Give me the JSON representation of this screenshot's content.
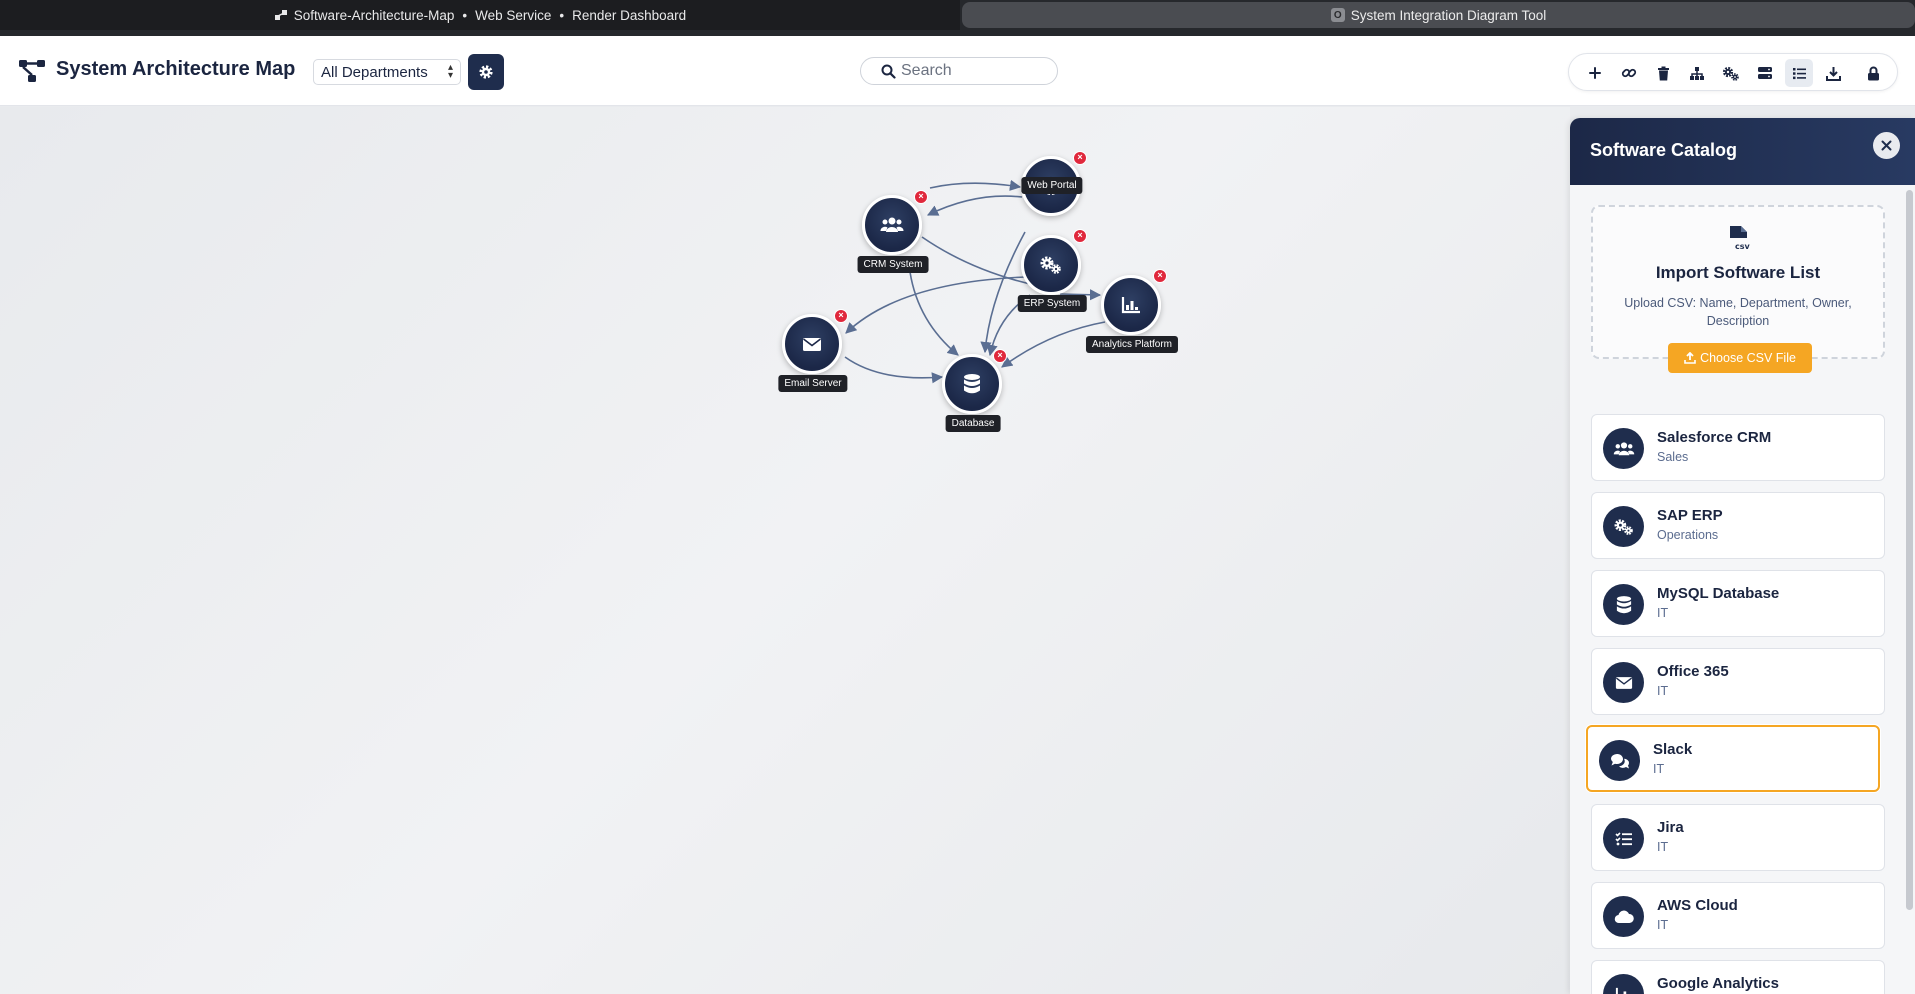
{
  "browser": {
    "tab_left": {
      "title": "Software-Architecture-Map",
      "sep1": "•",
      "part2": "Web Service",
      "sep2": "•",
      "part3": "Render Dashboard"
    },
    "tab_right": {
      "favicon_letter": "O",
      "title": "System Integration Diagram Tool"
    }
  },
  "header": {
    "title": "System Architecture Map",
    "department_select": {
      "value": "All Departments"
    },
    "search": {
      "placeholder": "Search"
    },
    "toolbar": [
      {
        "icon": "plus-icon",
        "tooltip": "add"
      },
      {
        "icon": "link-icon",
        "tooltip": "connect"
      },
      {
        "icon": "trash-icon",
        "tooltip": "delete"
      },
      {
        "icon": "sitemap-icon",
        "tooltip": "layout"
      },
      {
        "icon": "gears-icon",
        "tooltip": "settings"
      },
      {
        "icon": "server-icon",
        "tooltip": "servers"
      },
      {
        "icon": "list-icon",
        "tooltip": "catalog",
        "active": true
      },
      {
        "icon": "download-icon",
        "tooltip": "export"
      },
      {
        "icon": "lock-icon",
        "tooltip": "lock"
      }
    ]
  },
  "diagram": {
    "nodes": [
      {
        "id": "web",
        "label": "Web Portal",
        "icon": "globe-icon"
      },
      {
        "id": "crm",
        "label": "CRM System",
        "icon": "users-icon"
      },
      {
        "id": "erp",
        "label": "ERP System",
        "icon": "gears-icon"
      },
      {
        "id": "analytics",
        "label": "Analytics Platform",
        "icon": "chart-icon"
      },
      {
        "id": "email",
        "label": "Email Server",
        "icon": "envelope-icon"
      },
      {
        "id": "db",
        "label": "Database",
        "icon": "database-icon"
      }
    ]
  },
  "catalog": {
    "title": "Software Catalog",
    "import": {
      "title": "Import Software List",
      "description": "Upload CSV: Name, Department, Owner, Description",
      "button": "Choose CSV File"
    },
    "items": [
      {
        "name": "Salesforce CRM",
        "department": "Sales",
        "icon": "users-icon"
      },
      {
        "name": "SAP ERP",
        "department": "Operations",
        "icon": "gears-icon"
      },
      {
        "name": "MySQL Database",
        "department": "IT",
        "icon": "database-icon"
      },
      {
        "name": "Office 365",
        "department": "IT",
        "icon": "envelope-icon"
      },
      {
        "name": "Slack",
        "department": "IT",
        "icon": "comments-icon",
        "selected": true
      },
      {
        "name": "Jira",
        "department": "IT",
        "icon": "tasks-icon"
      },
      {
        "name": "AWS Cloud",
        "department": "IT",
        "icon": "cloud-icon"
      },
      {
        "name": "Google Analytics",
        "department": "",
        "icon": "chart-icon"
      }
    ]
  },
  "colors": {
    "navy": "#1f2d4d",
    "accent": "#f5a623",
    "danger": "#e0283c"
  }
}
